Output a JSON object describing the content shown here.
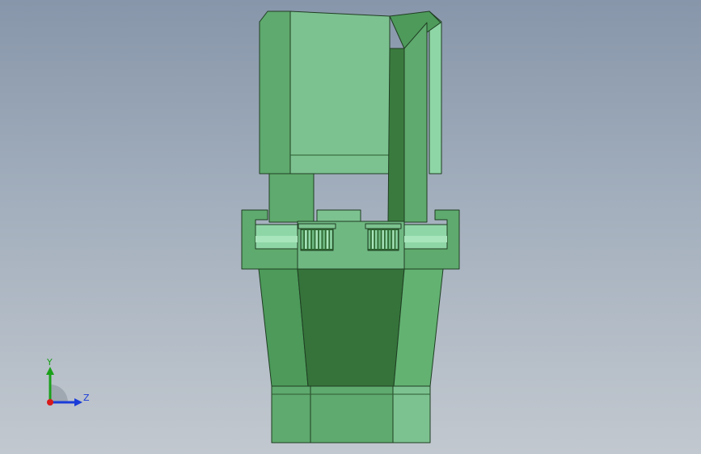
{
  "viewport": {
    "colors": {
      "bg_top": "#8796aa",
      "bg_bottom": "#c2c8cf",
      "light_green": "#7cc290",
      "mid_green": "#5faa6e",
      "dark_green": "#3a7a3e",
      "edge": "#1f3d22"
    }
  },
  "triad": {
    "y_label": "Y",
    "z_label": "Z",
    "colors": {
      "y": "#1aa01a",
      "z": "#1a3cd8",
      "x": "#d81a1a"
    }
  }
}
